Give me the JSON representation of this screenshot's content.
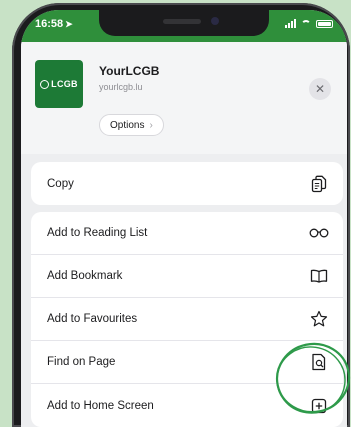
{
  "status_bar": {
    "time": "16:58"
  },
  "header": {
    "site_name": "YourLCGB",
    "site_url": "yourlcgb.lu",
    "options_label": "Options",
    "logo_text": "LCGB"
  },
  "menu": {
    "copy": {
      "label": "Copy",
      "icon": "copy-icon"
    },
    "reading_list": {
      "label": "Add to Reading List",
      "icon": "glasses-icon"
    },
    "bookmark": {
      "label": "Add Bookmark",
      "icon": "book-icon"
    },
    "favourites": {
      "label": "Add to Favourites",
      "icon": "star-icon"
    },
    "find": {
      "label": "Find on Page",
      "icon": "find-on-page-icon"
    },
    "home_screen": {
      "label": "Add to Home Screen",
      "icon": "plus-square-icon"
    }
  },
  "colors": {
    "status_bar": "#2f8f3b",
    "app_icon": "#1d7a36",
    "background": "#c8e2c6",
    "highlight_circle": "#2e9a4a"
  }
}
